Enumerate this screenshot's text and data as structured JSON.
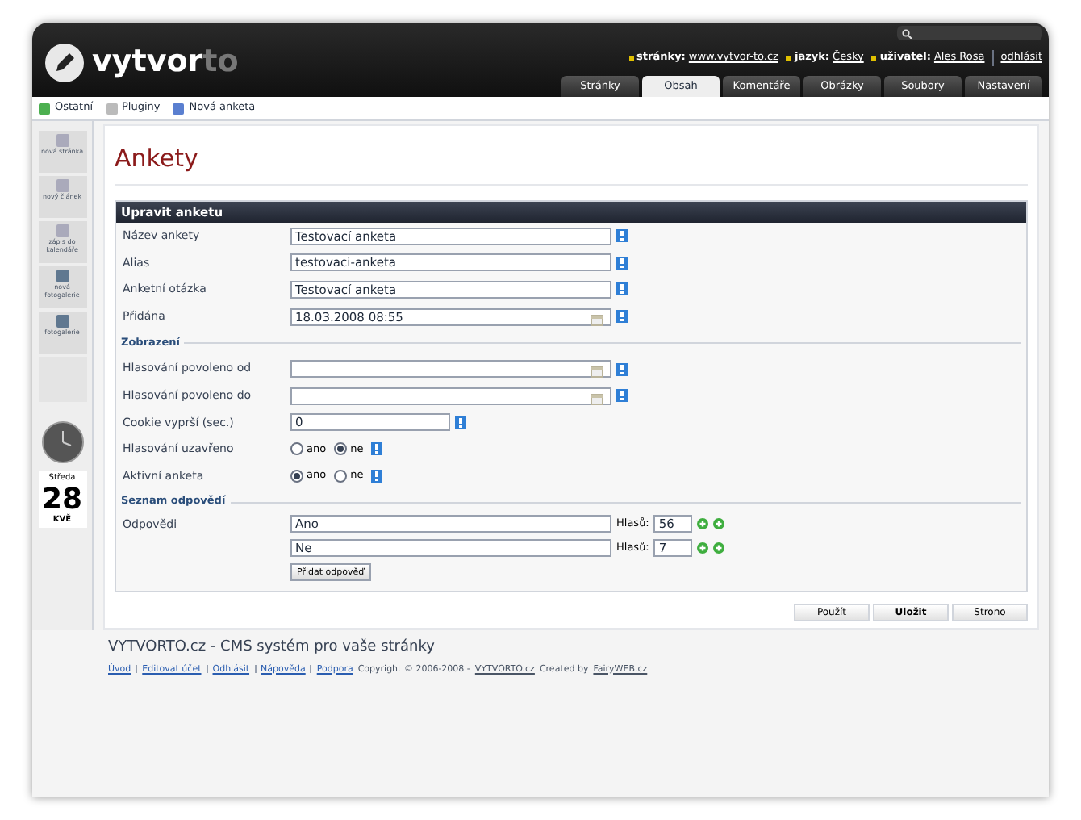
{
  "header": {
    "logo_main": "vytvor",
    "logo_accent": "to",
    "info": [
      {
        "label": "stránky:",
        "value": "www.vytvor-to.cz"
      },
      {
        "label": "jazyk:",
        "value": "Česky"
      },
      {
        "label": "uživatel:",
        "value": "Ales Rosa"
      }
    ],
    "logout": "odhlásit",
    "tabs": [
      {
        "label": "Stránky",
        "selected": false
      },
      {
        "label": "Obsah",
        "selected": true
      },
      {
        "label": "Komentáře",
        "selected": false
      },
      {
        "label": "Obrázky",
        "selected": false
      },
      {
        "label": "Soubory",
        "selected": false
      },
      {
        "label": "Nastavení",
        "selected": false
      }
    ]
  },
  "toolbar": [
    {
      "label": "Ostatní"
    },
    {
      "label": "Pluginy"
    },
    {
      "label": "Nová anketa"
    }
  ],
  "sidebar": {
    "items": [
      {
        "label": "nová stránka"
      },
      {
        "label": "nový článek"
      },
      {
        "label": "zápis do kalendáře"
      },
      {
        "label": "nová fotogalerie"
      },
      {
        "label": "fotogalerie"
      }
    ],
    "calendar": {
      "day": "Středa",
      "date": "28",
      "month": "KVĚ"
    }
  },
  "page_title": "Ankety",
  "form": {
    "title": "Upravit anketu",
    "rows": [
      {
        "kind": "text",
        "label": "Název ankety",
        "value": "Testovací anketa"
      },
      {
        "kind": "text",
        "label": "Alias",
        "value": "testovaci-anketa"
      },
      {
        "kind": "text",
        "label": "Anketní otázka",
        "value": "Testovací anketa"
      },
      {
        "kind": "date",
        "label": "Přidána",
        "value": "18.03.2008 08:55"
      },
      {
        "kind": "section",
        "label": "Zobrazení"
      },
      {
        "kind": "date",
        "label": "Hlasování povoleno od"
      },
      {
        "kind": "date",
        "label": "Hlasování povoleno do"
      },
      {
        "kind": "short",
        "label": "Cookie vyprší (sec.)",
        "value": "0"
      },
      {
        "kind": "radio",
        "label": "Hlasování uzavřeno",
        "options": [
          {
            "label": "ano",
            "selected": false
          },
          {
            "label": "ne",
            "selected": true
          }
        ]
      },
      {
        "kind": "radio",
        "label": "Aktivní anketa",
        "options": [
          {
            "label": "ano",
            "selected": true
          },
          {
            "label": "ne",
            "selected": false
          }
        ]
      },
      {
        "kind": "section",
        "label": "Seznam odpovědí"
      }
    ],
    "answers_label": "Odpovědi",
    "answers": [
      {
        "value": "Ano",
        "votes_label": "Hlasů:",
        "votes": "56"
      },
      {
        "value": "Ne",
        "votes_label": "Hlasů:",
        "votes": "7"
      }
    ],
    "add_button": "Přidat odpověď"
  },
  "buttons": [
    {
      "label": "Použít",
      "primary": false
    },
    {
      "label": "Uložit",
      "primary": true
    },
    {
      "label": "Strono",
      "primary": false
    }
  ],
  "footer": {
    "title": "VYTVORTO.cz - CMS systém pro vaše stránky",
    "links": [
      "Úvod",
      "Editovat účet",
      "Odhlásit",
      "Nápověda",
      "Podpora"
    ],
    "copyright": "Copyright © 2006-2008 -",
    "site": "VYTVORTO.cz",
    "created": "Created by",
    "author": "FairyWEB.cz"
  }
}
